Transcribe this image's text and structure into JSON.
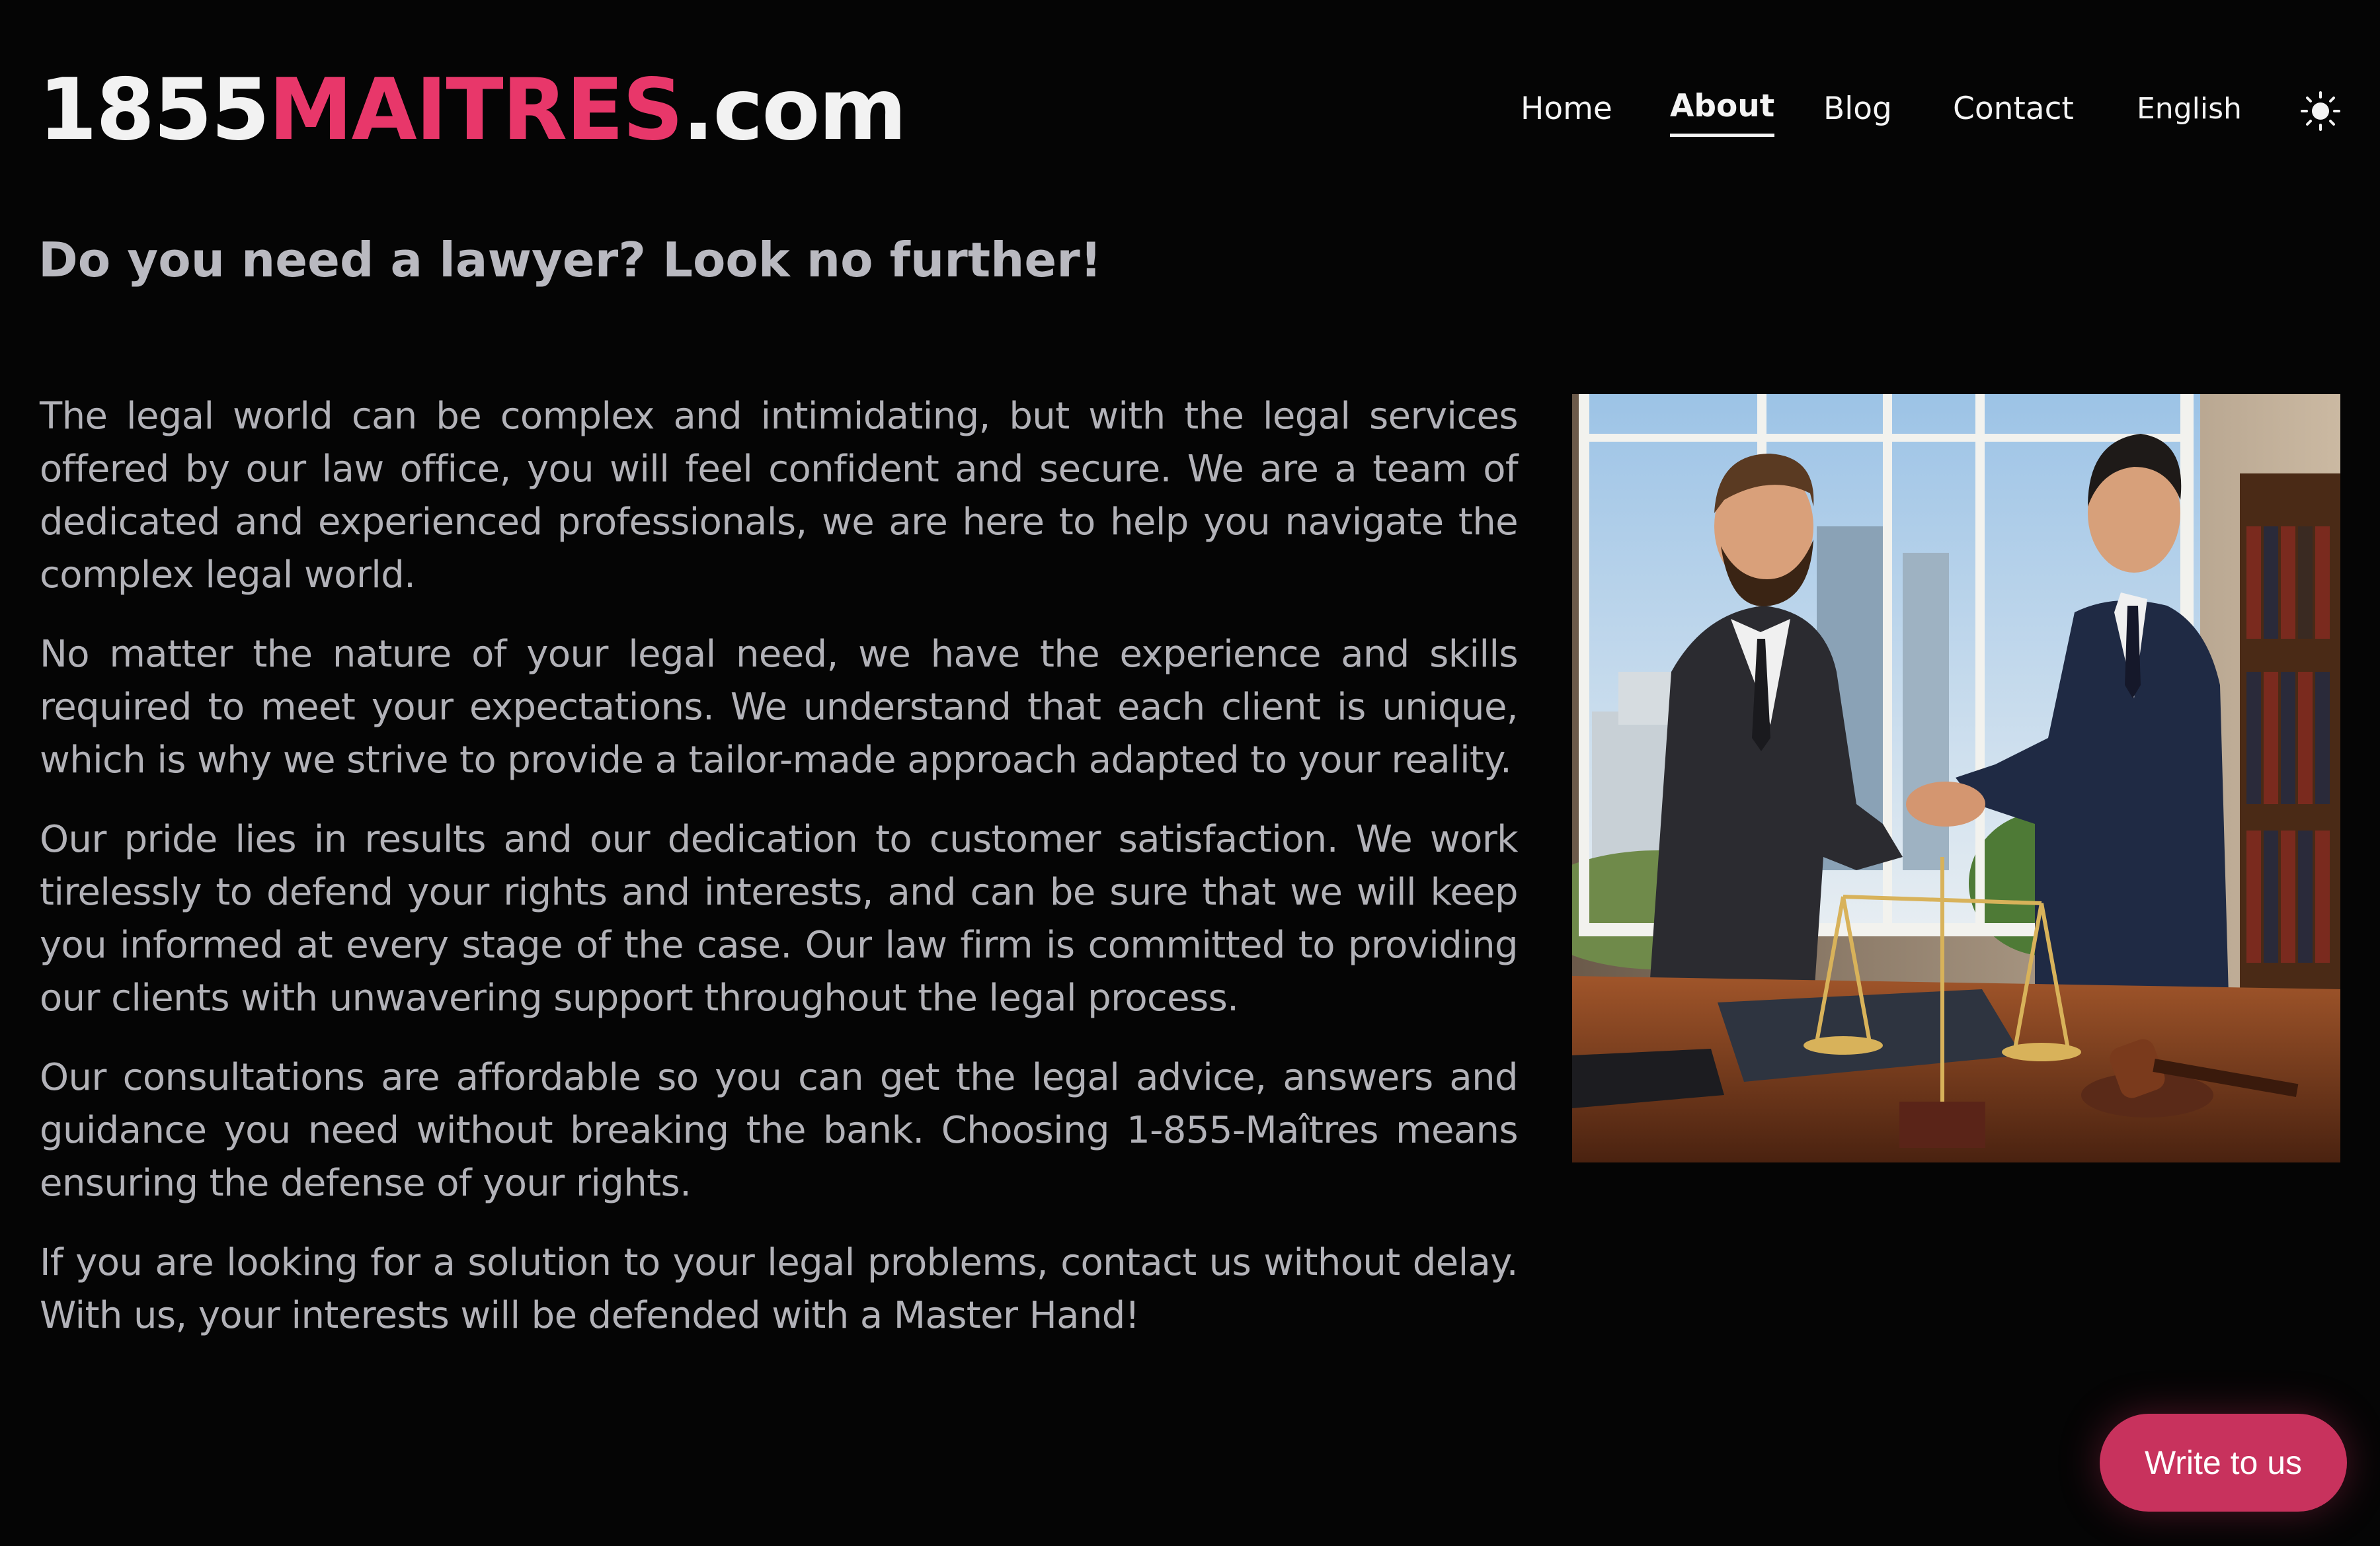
{
  "header": {
    "logo": {
      "part1": "1855",
      "part2": "MAITRES",
      "part3": ".com"
    },
    "nav": [
      {
        "label": "Home"
      },
      {
        "label": "About"
      },
      {
        "label": "Blog"
      },
      {
        "label": "Contact"
      }
    ],
    "active_nav": "About",
    "language": "English",
    "theme_icon": "sun-icon"
  },
  "main": {
    "headline": "Do you need a lawyer? Look no further!",
    "paragraphs": [
      "The legal world can be complex and intimidating, but with the legal services offered by our law office, you will feel confident and secure. We are a team of dedicated and experienced professionals, we are here to help you navigate the complex legal world.",
      "No matter the nature of your legal need, we have the experience and skills required to meet your expectations. We understand that each client is unique, which is why we strive to provide a tailor-made approach adapted to your reality.",
      "Our pride lies in results and our dedication to customer satisfaction. We work tirelessly to defend your rights and interests, and can be sure that we will keep you informed at every stage of the case. Our law firm is committed to providing our clients with unwavering support throughout the legal process.",
      "Our consultations are affordable so you can get the legal advice, answers and guidance you need without breaking the bank. Choosing 1-855-Maîtres means ensuring the defense of your rights.",
      "If you are looking for a solution to your legal problems, contact us without delay. With us, your interests will be defended with a Master Hand!"
    ]
  },
  "cta": {
    "write_label": "Write to us"
  },
  "colors": {
    "background": "#050505",
    "brand_pink": "#e8376a",
    "button_pink": "#c8325d",
    "body_text": "#b2b2b8",
    "headline_text": "#b9b9c0",
    "nav_text": "#f4f4f4"
  }
}
